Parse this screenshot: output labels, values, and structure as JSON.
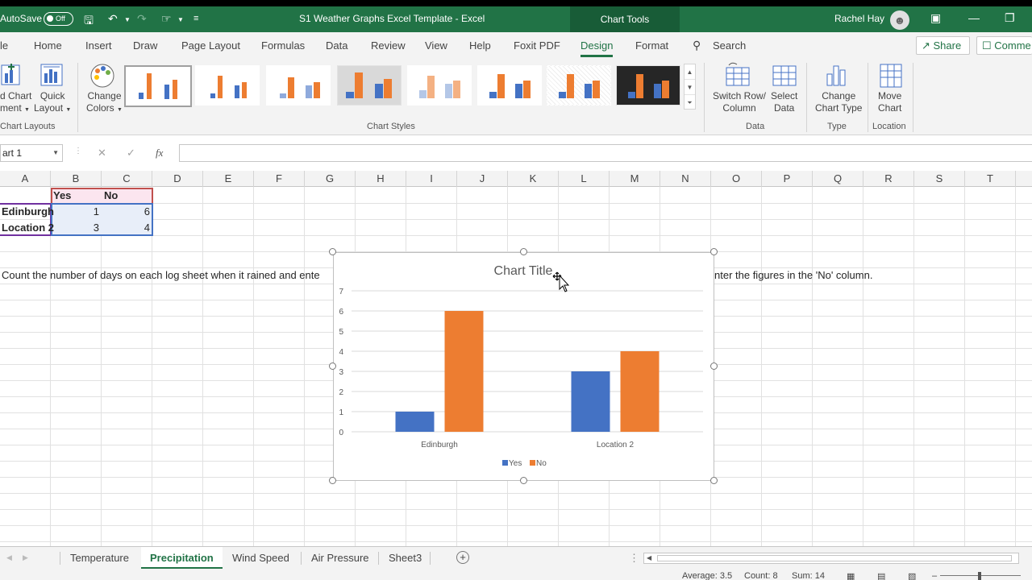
{
  "titlebar": {
    "autosave_label": "AutoSave",
    "autosave_state": "Off",
    "document_title": "S1 Weather Graphs Excel Template  -  Excel",
    "context_tab": "Chart Tools",
    "user_name": "Rachel Hay"
  },
  "tabs": {
    "items": [
      "le",
      "Home",
      "Insert",
      "Draw",
      "Page Layout",
      "Formulas",
      "Data",
      "Review",
      "View",
      "Help",
      "Foxit PDF",
      "Design",
      "Format"
    ],
    "search": "Search",
    "share": "Share",
    "comments": "Comme"
  },
  "ribbon": {
    "add_chart_element": [
      "d Chart",
      "ment"
    ],
    "quick_layout": [
      "Quick",
      "Layout"
    ],
    "change_colors": [
      "Change",
      "Colors"
    ],
    "switch_row_column": [
      "Switch Row/",
      "Column"
    ],
    "select_data": [
      "Select",
      "Data"
    ],
    "change_chart_type": [
      "Change",
      "Chart Type"
    ],
    "move_chart": [
      "Move",
      "Chart"
    ],
    "groups": {
      "chart_layouts": "Chart Layouts",
      "chart_styles": "Chart Styles",
      "data": "Data",
      "type": "Type",
      "location": "Location"
    }
  },
  "formula_bar": {
    "name_box": "art 1",
    "fx": "fx",
    "value": ""
  },
  "grid": {
    "columns": [
      "A",
      "B",
      "C",
      "D",
      "E",
      "F",
      "G",
      "H",
      "I",
      "J",
      "K",
      "L",
      "M",
      "N",
      "O",
      "P",
      "Q",
      "R",
      "S",
      "T"
    ],
    "header_yes": "Yes",
    "header_no": "No",
    "row1_label": "Edinburgh",
    "row1_yes": "1",
    "row1_no": "6",
    "row2_label": "Location 2",
    "row2_yes": "3",
    "row2_no": "4",
    "instruction_left": "Count the number of days on each log sheet when it rained and ente",
    "instruction_right": "nter the figures in the 'No' column."
  },
  "chart_data": {
    "type": "bar",
    "title": "Chart Title",
    "categories": [
      "Edinburgh",
      "Location 2"
    ],
    "series": [
      {
        "name": "Yes",
        "values": [
          1,
          3
        ],
        "color": "#4472c4"
      },
      {
        "name": "No",
        "values": [
          6,
          4
        ],
        "color": "#ed7d31"
      }
    ],
    "ylim": [
      0,
      7
    ],
    "yticks": [
      "0",
      "1",
      "2",
      "3",
      "4",
      "5",
      "6",
      "7"
    ],
    "grid": true,
    "legend": "bottom"
  },
  "sheet_tabs": {
    "items": [
      "Temperature",
      "Precipitation",
      "Wind Speed",
      "Air Pressure",
      "Sheet3"
    ],
    "active": "Precipitation"
  },
  "status": {
    "average": "Average: 3.5",
    "count": "Count: 8",
    "sum": "Sum: 14"
  },
  "colors": {
    "excel_green": "#217346",
    "series_yes": "#4472c4",
    "series_no": "#ed7d31"
  }
}
